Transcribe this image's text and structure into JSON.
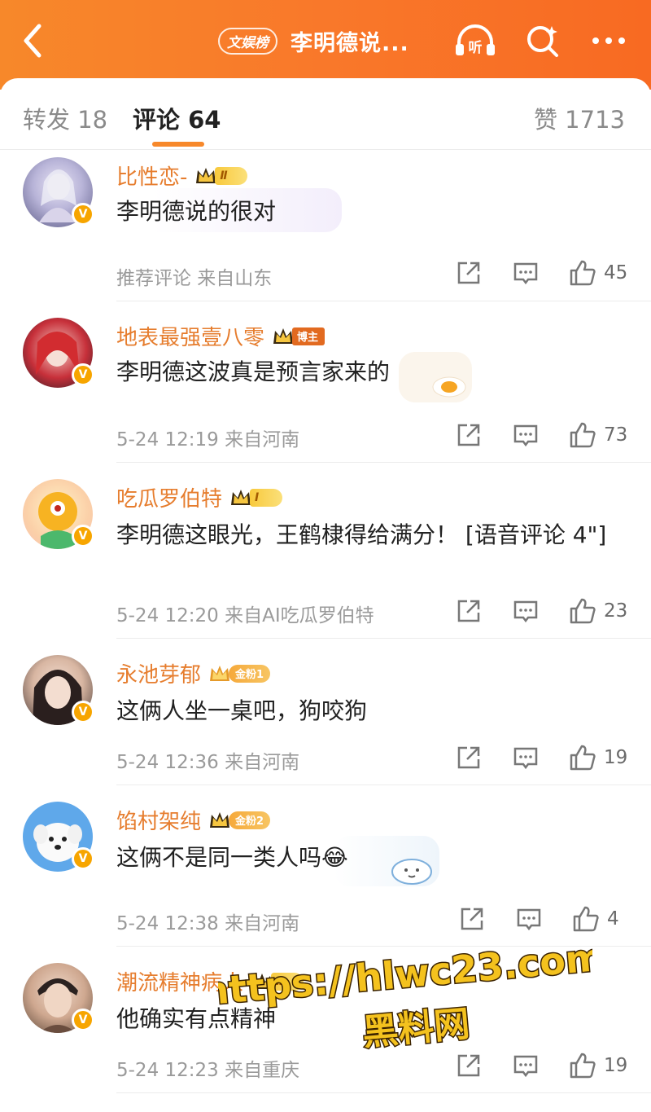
{
  "header": {
    "tag": "文娱榜",
    "title": "李明德说..."
  },
  "tabs": {
    "forward_label": "转发 18",
    "comments_label": "评论 64",
    "likes_label": "赞 1713"
  },
  "comments": [
    {
      "name": "比性恋-",
      "badge": "Ⅱ",
      "text": "李明德说的很对",
      "meta": "推荐评论  来自山东",
      "likes": "45"
    },
    {
      "name": "地表最强壹八零",
      "badge": "博主",
      "text": "李明德这波真是预言家来的",
      "meta": "5-24 12:19  来自河南",
      "likes": "73"
    },
    {
      "name": "吃瓜罗伯特",
      "badge": "Ⅰ",
      "text": "李明德这眼光，王鹤棣得给满分！ [语音评论 4\"]",
      "meta": "5-24 12:20  来自AI吃瓜罗伯特",
      "likes": "23"
    },
    {
      "name": "永池芽郁",
      "badge": "金粉1",
      "text": "这俩人坐一桌吧，狗咬狗",
      "meta": "5-24 12:36  来自河南",
      "likes": "19"
    },
    {
      "name": "馅村架纯",
      "badge": "金粉2",
      "text": "这俩不是同一类人吗😂",
      "meta": "5-24 12:38  来自河南",
      "likes": "4"
    },
    {
      "name": "潮流精神病人",
      "badge": "Ⅱ",
      "text": "他确实有点精神",
      "meta": "5-24 12:23  来自重庆",
      "likes": "19"
    }
  ],
  "watermark": {
    "line1": "https://hlwc23.com",
    "line2": "黑料网"
  },
  "colors": {
    "header_orange": "#f7882a",
    "name_orange": "#e67d2e",
    "verified_yellow": "#f7a500"
  }
}
